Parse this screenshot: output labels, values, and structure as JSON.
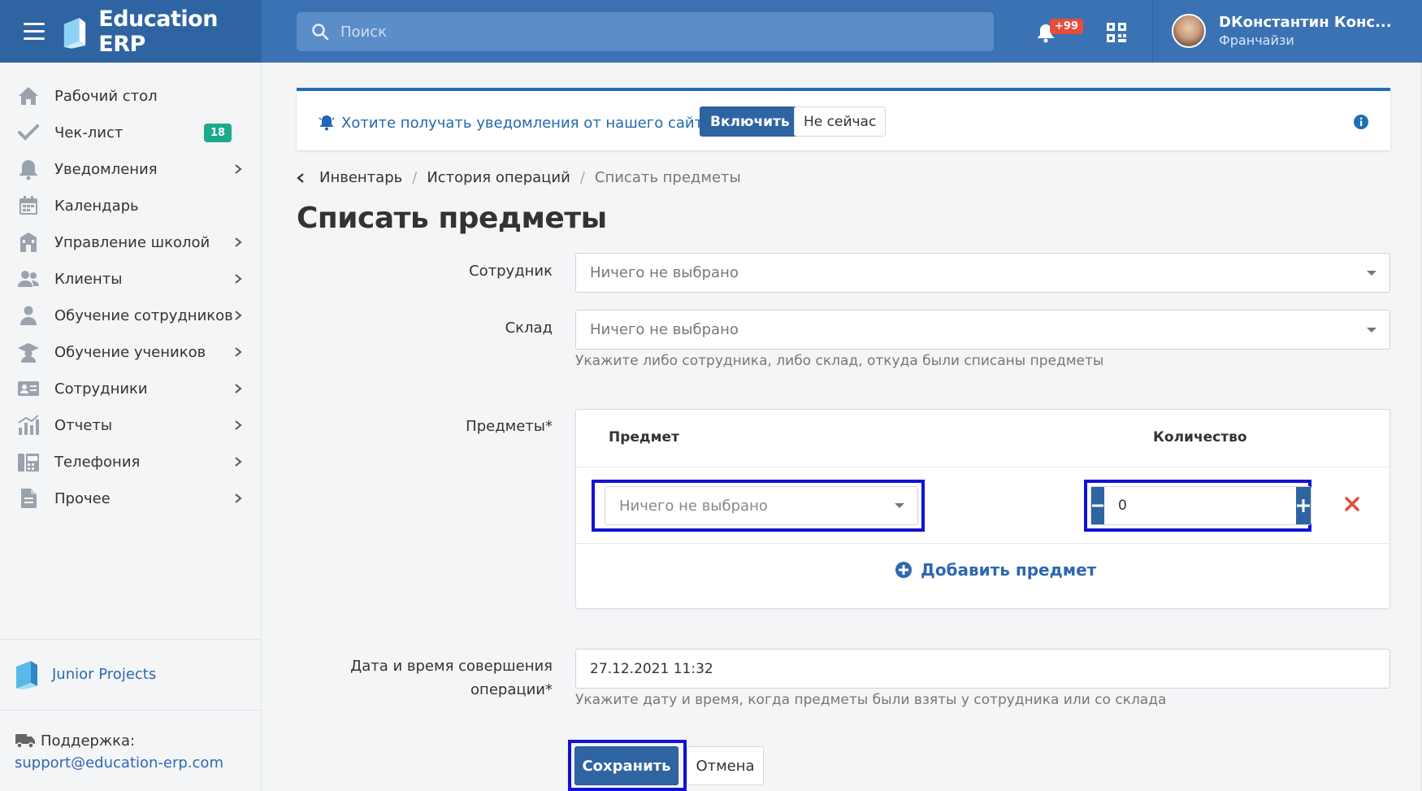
{
  "app": {
    "title": "Education ERP"
  },
  "header": {
    "search_placeholder": "Поиск",
    "notifications_badge": "+99",
    "user_name": "DКонстантин Конс...",
    "user_role": "Франчайзи"
  },
  "sidebar": {
    "items": [
      {
        "label": "Рабочий стол",
        "icon": "home-icon"
      },
      {
        "label": "Чек-лист",
        "icon": "check-icon",
        "badge": "18"
      },
      {
        "label": "Уведомления",
        "icon": "bell-icon"
      },
      {
        "label": "Календарь",
        "icon": "calendar-icon"
      },
      {
        "label": "Управление школой",
        "icon": "school-icon"
      },
      {
        "label": "Клиенты",
        "icon": "users-icon"
      },
      {
        "label": "Обучение сотрудников",
        "icon": "staff-training-icon"
      },
      {
        "label": "Обучение учеников",
        "icon": "graduation-cap-icon"
      },
      {
        "label": "Сотрудники",
        "icon": "id-card-icon"
      },
      {
        "label": "Отчеты",
        "icon": "chart-icon"
      },
      {
        "label": "Телефония",
        "icon": "fax-icon"
      },
      {
        "label": "Прочее",
        "icon": "file-icon"
      }
    ],
    "footer_brand": "Junior Projects",
    "support_title": "Поддержка:",
    "support_email": "support@education-erp.com"
  },
  "banner": {
    "text": "Хотите получать уведомления от нашего сайта?",
    "enable_label": "Включить",
    "later_label": "Не сейчас"
  },
  "breadcrumbs": {
    "items": [
      "Инвентарь",
      "История операций"
    ],
    "current": "Списать предметы"
  },
  "page": {
    "title": "Списать предметы"
  },
  "form": {
    "employee_label": "Сотрудник",
    "employee_value": "Ничего не выбрано",
    "warehouse_label": "Склад",
    "warehouse_value": "Ничего не выбрано",
    "warehouse_help": "Укажите либо сотрудника, либо склад, откуда были списаны предметы",
    "items_label": "Предметы*",
    "items_table": {
      "col_item": "Предмет",
      "col_qty": "Количество",
      "rows": [
        {
          "item": "Ничего не выбрано",
          "qty": "0"
        }
      ],
      "add_label": "Добавить предмет"
    },
    "datetime_label_line1": "Дата и время совершения",
    "datetime_label_line2": "операции*",
    "datetime_value": "27.12.2021 11:32",
    "datetime_help": "Укажите дату и время, когда предметы были взяты у сотрудника или со склада",
    "save_label": "Сохранить",
    "cancel_label": "Отмена"
  },
  "colors": {
    "header": "#3a72b4",
    "brand_block": "#2f64a2",
    "primary_button": "#2f64a2",
    "badge_green": "#1aaa8c",
    "badge_red": "#e74c3c",
    "highlight_border": "#1212d6",
    "link": "#2d68b3"
  }
}
